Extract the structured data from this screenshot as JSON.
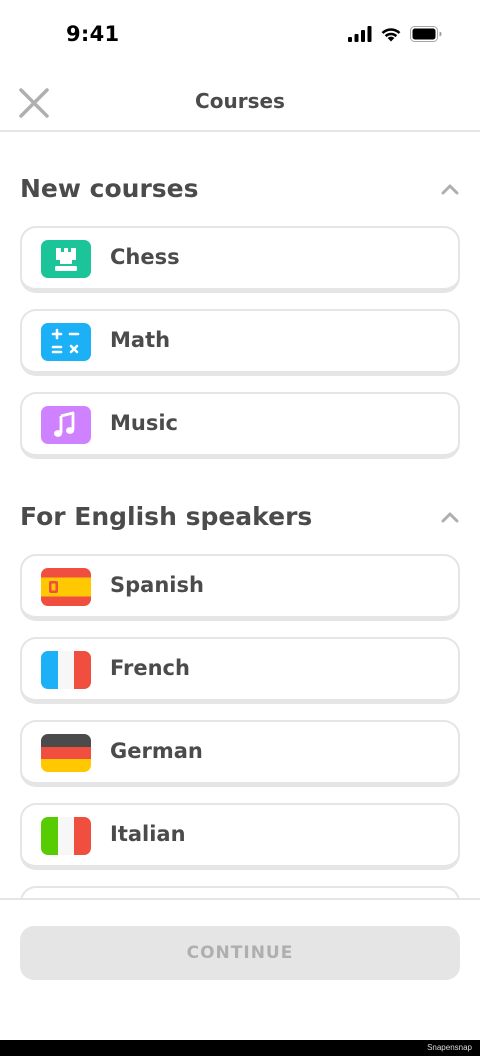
{
  "status_bar": {
    "time": "9:41",
    "icons": [
      "signal-icon",
      "wifi-icon",
      "battery-icon"
    ]
  },
  "header": {
    "title": "Courses",
    "close_icon": "close-icon"
  },
  "sections": [
    {
      "title": "New courses",
      "expanded": true,
      "courses": [
        {
          "label": "Chess",
          "icon": "chess-rook-icon",
          "color": "#1cc49a"
        },
        {
          "label": "Math",
          "icon": "math-operators-icon",
          "color": "#1cb0f6"
        },
        {
          "label": "Music",
          "icon": "music-note-icon",
          "color": "#ce82ff"
        }
      ]
    },
    {
      "title": "For English speakers",
      "expanded": true,
      "courses": [
        {
          "label": "Spanish",
          "icon": "spain-flag-icon"
        },
        {
          "label": "French",
          "icon": "france-flag-icon"
        },
        {
          "label": "German",
          "icon": "germany-flag-icon"
        },
        {
          "label": "Italian",
          "icon": "italy-flag-icon"
        }
      ]
    }
  ],
  "footer": {
    "continue_label": "CONTINUE"
  },
  "watermark": "Snapensnap"
}
